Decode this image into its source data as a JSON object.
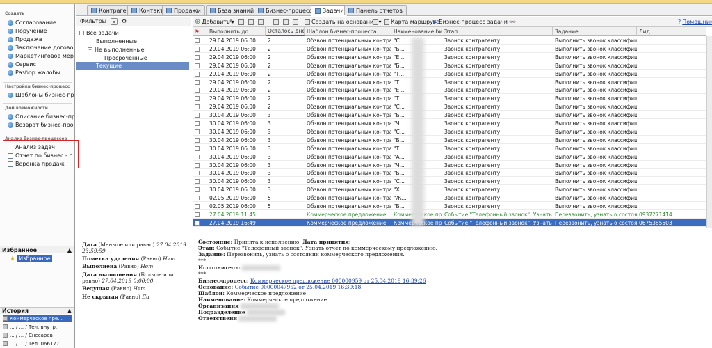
{
  "left": {
    "sections": [
      {
        "title": "Создать",
        "items": [
          "Согласование",
          "Поручение",
          "Продажа",
          "Заключение догово",
          "Маркетинговое мер",
          "Сервис",
          "Разбор жалобы"
        ]
      },
      {
        "title": "Настройка бизнес-процесс",
        "items": [
          "Шаблоны бизнес-пр"
        ]
      },
      {
        "title": "Доп.возможности",
        "items": [
          "Описание бизнес-пр",
          "Возврат бизнес-про"
        ]
      },
      {
        "title": "Анализ бизнес-процессов",
        "items": [
          "Анализ задач",
          "Отчет по бизнес - п",
          "Воронка продаж"
        ]
      }
    ],
    "favorites_title": "Избранное",
    "favorites_item": "Избранное",
    "history_title": "История",
    "history_items": [
      "Коммерческое пре...",
      "... / ... / Тел. внутр.:",
      "... / ... / Снесарев",
      "... / ... / Тел.:066177"
    ]
  },
  "tabs": [
    "Контрагенты",
    "Контакты",
    "Продажи",
    "База знаний",
    "Бизнес-процессы",
    "Задачи",
    "Панель отчетов"
  ],
  "tree": {
    "toolbar_label": "Фильтры",
    "nodes": [
      "Все задачи",
      "Выполненные",
      "Не выполненные",
      "Просроченные",
      "Текущие"
    ]
  },
  "grid_toolbar": {
    "add": "Добавить",
    "create_based": "Создать на основании",
    "route_map": "Карта маршрута",
    "bp_task": "Бизнес-процесс задачи",
    "help": "Помощник"
  },
  "grid": {
    "headers": [
      "Выполнить до",
      "Осталось дней",
      "Шаблон бизнес-процесса",
      "Наименование биз...",
      "Этап",
      "Задание",
      "Лид"
    ],
    "rows": [
      {
        "date": "29.04.2019 06:00",
        "days": "2",
        "tpl": "Обзвон потенциальных контрагент...",
        "name": "\"С...",
        "stage": "Звонок контрагенту",
        "task": "Выполнить звонок классифициро...",
        "lead": "",
        "style": ""
      },
      {
        "date": "29.04.2019 06:00",
        "days": "2",
        "tpl": "Обзвон потенциальных контрагент...",
        "name": "\"Б...",
        "stage": "Звонок контрагенту",
        "task": "Выполнить звонок классифициро...",
        "lead": "",
        "style": ""
      },
      {
        "date": "29.04.2019 06:00",
        "days": "2",
        "tpl": "Обзвон потенциальных контрагент...",
        "name": "\"Е...",
        "stage": "Звонок контрагенту",
        "task": "Выполнить звонок классифициро...",
        "lead": "",
        "style": ""
      },
      {
        "date": "29.04.2019 06:00",
        "days": "2",
        "tpl": "Обзвон потенциальных контрагент...",
        "name": "\"Б...",
        "stage": "Звонок контрагенту",
        "task": "Выполнить звонок классифициро...",
        "lead": "",
        "style": ""
      },
      {
        "date": "29.04.2019 06:00",
        "days": "2",
        "tpl": "Обзвон потенциальных контрагент...",
        "name": "\"Т...",
        "stage": "Звонок контрагенту",
        "task": "Выполнить звонок классифициро...",
        "lead": "",
        "style": ""
      },
      {
        "date": "29.04.2019 06:00",
        "days": "2",
        "tpl": "Обзвон потенциальных контрагент...",
        "name": "\"Т...",
        "stage": "Звонок контрагенту",
        "task": "Выполнить звонок классифициро...",
        "lead": "",
        "style": ""
      },
      {
        "date": "29.04.2019 06:00",
        "days": "2",
        "tpl": "Обзвон потенциальных контрагент...",
        "name": "\"Е...",
        "stage": "Звонок контрагенту",
        "task": "Выполнить звонок классифициро...",
        "lead": "",
        "style": ""
      },
      {
        "date": "29.04.2019 06:00",
        "days": "2",
        "tpl": "Обзвон потенциальных контрагент...",
        "name": "\"Т...",
        "stage": "Звонок контрагенту",
        "task": "Выполнить звонок классифициро...",
        "lead": "",
        "style": ""
      },
      {
        "date": "29.04.2019 06:00",
        "days": "2",
        "tpl": "Обзвон потенциальных контрагент...",
        "name": "\"С...",
        "stage": "Звонок контрагенту",
        "task": "Выполнить звонок классифициро...",
        "lead": "",
        "style": ""
      },
      {
        "date": "30.04.2019 06:00",
        "days": "3",
        "tpl": "Обзвон потенциальных контрагент...",
        "name": "\"Б...",
        "stage": "Звонок контрагенту",
        "task": "Выполнить звонок классифициро...",
        "lead": "",
        "style": ""
      },
      {
        "date": "30.04.2019 06:00",
        "days": "3",
        "tpl": "Обзвон потенциальных контрагент...",
        "name": "\"Ч...",
        "stage": "Звонок контрагенту",
        "task": "Выполнить звонок классифициро...",
        "lead": "",
        "style": ""
      },
      {
        "date": "30.04.2019 06:00",
        "days": "3",
        "tpl": "Обзвон потенциальных контрагент...",
        "name": "\"С...",
        "stage": "Звонок контрагенту",
        "task": "Выполнить звонок классифициро...",
        "lead": "",
        "style": ""
      },
      {
        "date": "30.04.2019 06:00",
        "days": "3",
        "tpl": "Обзвон потенциальных контрагент...",
        "name": "\"Б...",
        "stage": "Звонок контрагенту",
        "task": "Выполнить звонок классифициро...",
        "lead": "",
        "style": ""
      },
      {
        "date": "30.04.2019 06:00",
        "days": "3",
        "tpl": "Обзвон потенциальных контрагент...",
        "name": "\"Т...",
        "stage": "Звонок контрагенту",
        "task": "Выполнить звонок классифициро...",
        "lead": "",
        "style": ""
      },
      {
        "date": "30.04.2019 06:00",
        "days": "3",
        "tpl": "Обзвон потенциальных контрагент...",
        "name": "\"А...",
        "stage": "Звонок контрагенту",
        "task": "Выполнить звонок классифициро...",
        "lead": "",
        "style": ""
      },
      {
        "date": "30.04.2019 06:00",
        "days": "3",
        "tpl": "Обзвон потенциальных контрагент...",
        "name": "\"Ч...",
        "stage": "Звонок контрагенту",
        "task": "Выполнить звонок классифициро...",
        "lead": "",
        "style": ""
      },
      {
        "date": "30.04.2019 06:00",
        "days": "3",
        "tpl": "Обзвон потенциальных контрагент...",
        "name": "\"Б...",
        "stage": "Звонок контрагенту",
        "task": "Выполнить звонок классифициро...",
        "lead": "",
        "style": ""
      },
      {
        "date": "30.04.2019 06:00",
        "days": "3",
        "tpl": "Обзвон потенциальных контрагент...",
        "name": "\"С...",
        "stage": "Звонок контрагенту",
        "task": "Выполнить звонок классифициро...",
        "lead": "",
        "style": ""
      },
      {
        "date": "30.04.2019 06:00",
        "days": "3",
        "tpl": "Обзвон потенциальных контрагент...",
        "name": "\"Х...",
        "stage": "Звонок контрагенту",
        "task": "Выполнить звонок классифициро...",
        "lead": "",
        "style": ""
      },
      {
        "date": "02.05.2019 06:00",
        "days": "5",
        "tpl": "Обзвон потенциальных контрагент...",
        "name": "\"Ж...",
        "stage": "Звонок контрагенту",
        "task": "Выполнить звонок классифициро...",
        "lead": "",
        "style": ""
      },
      {
        "date": "02.05.2019 06:00",
        "days": "5",
        "tpl": "Обзвон потенциальных контрагент...",
        "name": "\"Б...",
        "stage": "Звонок контрагенту",
        "task": "Выполнить звонок классифициро...",
        "lead": "",
        "style": ""
      },
      {
        "date": "27.04.2019 11:45",
        "days": "",
        "tpl": "Коммерческое предложение",
        "name": "Коммерческое пре...",
        "stage": "Событие \"Телефонный звонок\". Узнать отчет...",
        "task": "Перезвонить, узнать о состоянии ...",
        "lead": "0937271414",
        "style": "green"
      },
      {
        "date": "27.04.2019 16:49",
        "days": "",
        "tpl": "Коммерческое предложение",
        "name": "Коммерческое пре...",
        "stage": "Событие \"Телефонный звонок\". Узнать отчет...",
        "task": "Перезвонить, узнать о состоянии ...",
        "lead": "0675385503",
        "style": "selected"
      }
    ]
  },
  "filter_desc": [
    {
      "label": "Дата",
      "cond": " (Меньше или равно) ",
      "val": "27.04.2019 23:59:59"
    },
    {
      "label": "Пометка удаления",
      "cond": " (Равно) ",
      "val": "Нет"
    },
    {
      "label": "Выполнена",
      "cond": " (Равно) ",
      "val": "Нет"
    },
    {
      "label": "Дата выполнения",
      "cond": " (Больше или равно) ",
      "val": "27.04.2019 0:00:00"
    },
    {
      "label": "Ведущая",
      "cond": " (Равно) ",
      "val": "Нет"
    },
    {
      "label": "Не скрытая",
      "cond": " (Равно) ",
      "val": "Да"
    }
  ],
  "detail": {
    "state_label": "Состояние:",
    "state_val": "Принята к исполнению.",
    "accept_label": "Дата принятия:",
    "stage_label": "Этап:",
    "stage_val": "Событие \"Телефонный звонок\". Узнать отчет по коммерческому предложению.",
    "task_label": "Задание:",
    "task_val": "Перезвонить, узнать о состоянии коммерческого предложения.",
    "stars1": "***",
    "performer_label": "Исполнитель:",
    "stars2": "***",
    "bp_label": "Бизнес-процесс:",
    "bp_val": "Коммерческое предложение 000000959 от 25.04.2019 16:39:26",
    "base_label": "Основание:",
    "base_val": "Событие 00000047952 от 25.04.2019 16:39:18",
    "tpl_label": "Шаблон:",
    "tpl_val": "Коммерческое предложение",
    "name_label": "Наименование:",
    "name_val": "Коммерческое предложение",
    "org_label": "Организация",
    "dept_label": "Подразделение",
    "resp_label": "Ответственн"
  },
  "colors": {
    "highlight_box": "#d7242a",
    "selected_row": "#3a6cc0",
    "green_row": "#2d8a2d"
  }
}
